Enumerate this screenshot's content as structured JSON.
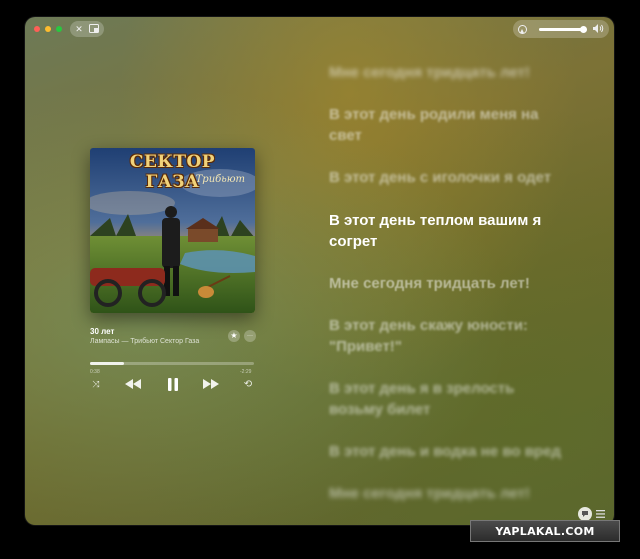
{
  "window": {
    "traffic_lights": [
      "#ff5f57",
      "#febc2e",
      "#28c840"
    ]
  },
  "mini_controls": {
    "close_glyph": "✕",
    "picture_in_picture_icon": "miniplayer-icon"
  },
  "volume": {
    "level": 0.86,
    "airplay_icon": "airplay-icon",
    "speaker_icon": "speaker-icon"
  },
  "album": {
    "cover_title": "СЕКТОР ГАЗА",
    "cover_subtitle": "Трибьют"
  },
  "track": {
    "title": "30 лет",
    "artist_album": "Лампасы — Трибьют Сектор Газа",
    "favorite_glyph": "★",
    "more_glyph": "···"
  },
  "progress": {
    "elapsed": "0:38",
    "remaining": "-2:29",
    "fraction": 0.21
  },
  "controls": {
    "shuffle": "⤨",
    "previous": "◀◀",
    "pause": "❚❚",
    "next": "▶▶",
    "repeat": "⟲"
  },
  "lyrics": [
    {
      "text": "Мне сегодня тридцать лет!",
      "active": false
    },
    {
      "text": "В этот день родили меня на свет",
      "active": false
    },
    {
      "text": "В этот день с иголочки я одет",
      "active": false
    },
    {
      "text": "В этот день теплом вашим я согрет",
      "active": true
    },
    {
      "text": "Мне сегодня тридцать лет!",
      "active": false
    },
    {
      "text": "В этот день скажу юности: \"Привет!\"",
      "active": false
    },
    {
      "text": "В этот день я в зрелость возьму билет",
      "active": false
    },
    {
      "text": "В этот день и водка не во вред",
      "active": false
    },
    {
      "text": "Мне сегодня тридцать лет!",
      "active": false
    }
  ],
  "bottom_buttons": {
    "lyrics_icon": "lyrics-icon",
    "queue_icon": "queue-list-icon"
  },
  "watermark": {
    "text": "YAPLAKAL.COM"
  },
  "colors": {
    "accent": "#ffffff",
    "background": "#6f6a2c"
  }
}
